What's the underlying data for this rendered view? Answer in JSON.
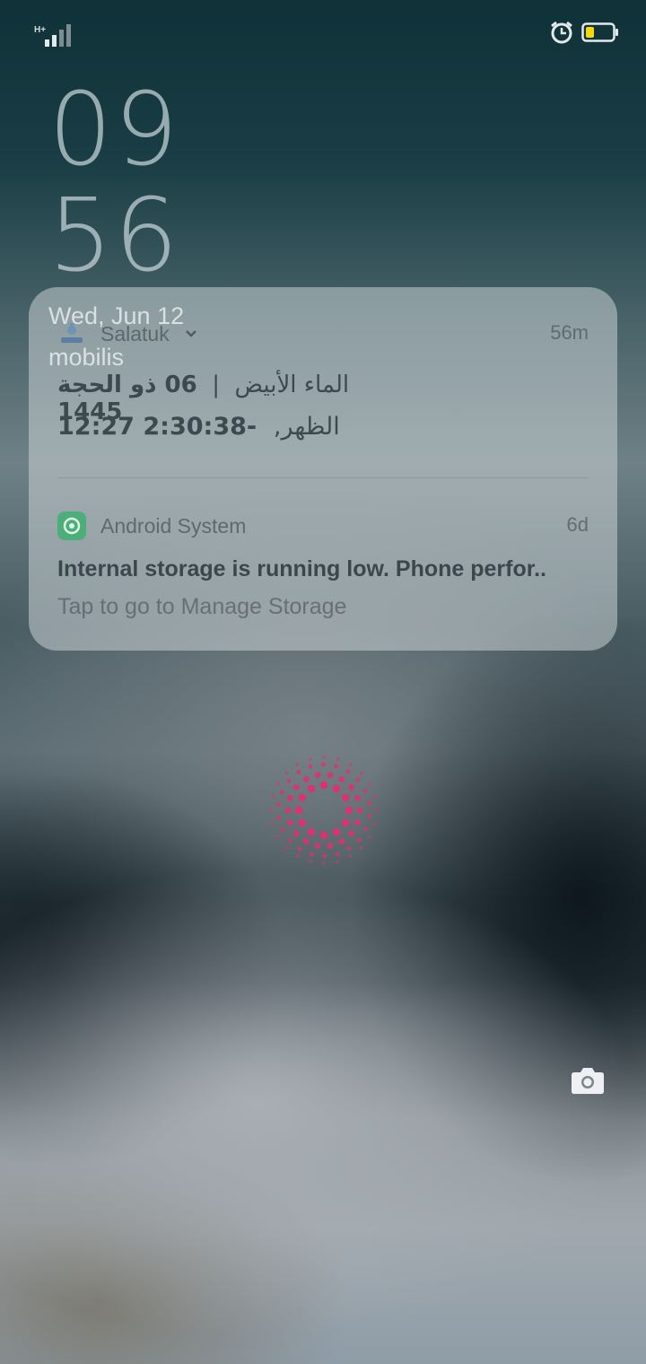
{
  "status_bar": {
    "network_type": "H+",
    "icons": [
      "signal-icon",
      "alarm-icon",
      "battery-icon"
    ],
    "battery_color": "#f5d90a"
  },
  "lockscreen": {
    "hour": "09",
    "minute": "56",
    "date": "Wed, Jun 12",
    "carrier": "mobilis"
  },
  "notifications": [
    {
      "app_name": "Salatuk",
      "time_ago": "56m",
      "line1_hijri": "06 ذو الحجة 1445",
      "line1_separator": "|",
      "line1_location": "الماء الأبيض",
      "line2_time": "12:27",
      "line2_prayer": "الظهر,",
      "line2_countdown": "-2:30:38"
    },
    {
      "app_name": "Android System",
      "time_ago": "6d",
      "title": "Internal storage is running low. Phone perfor..",
      "body": "Tap to go to Manage Storage"
    }
  ],
  "accent_colors": {
    "fingerprint": "#e0306f",
    "android_system_icon": "#4caf7a"
  }
}
